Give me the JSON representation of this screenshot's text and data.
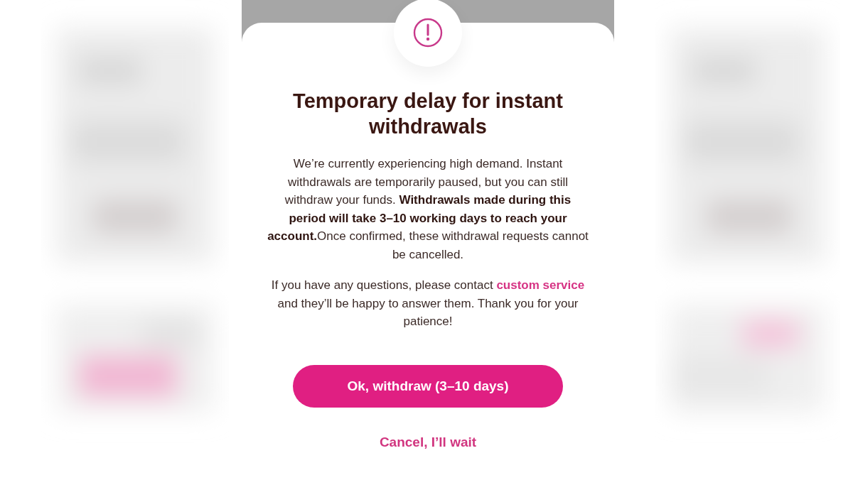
{
  "dialog": {
    "title": "Temporary delay for instant withdrawals",
    "message": "We’re currently experiencing high demand. Instant withdrawals are temporarily paused, but you can still withdraw your funds. **Withdrawals made during this period will take 3–10 working days to reach your account.**Once confirmed, these withdrawal requests cannot be cancelled.",
    "contact": {
      "before": "If you have any questions, please contact ",
      "link": "custom service",
      "after": " and they’ll be happy to answer them. Thank you for your patience!"
    },
    "primary_button": "Ok, withdraw (3–10 days)",
    "secondary_button": "Cancel, I’ll wait"
  }
}
